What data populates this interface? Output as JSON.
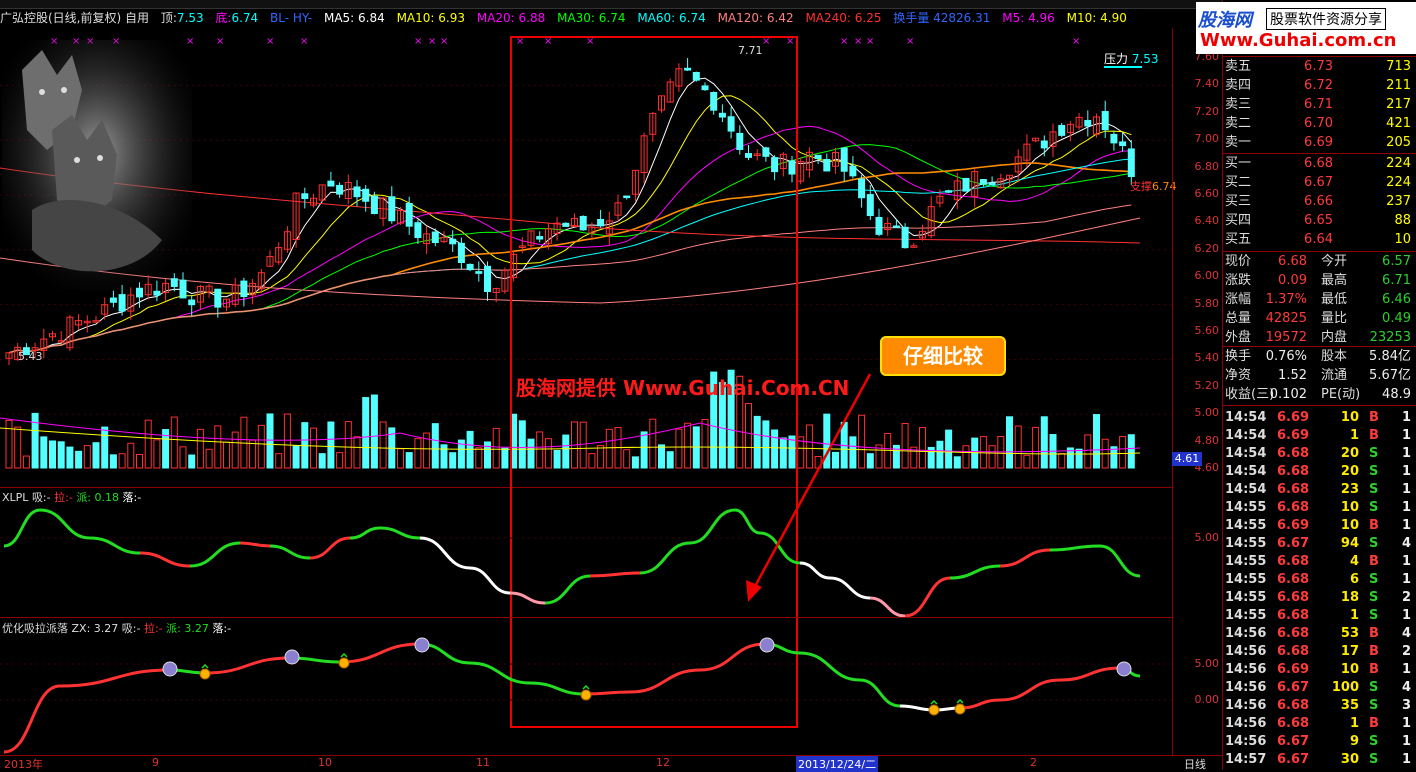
{
  "header": {
    "stock": "广弘控股(日线,前复权) 自用",
    "top_label": "顶:",
    "top_val": "7.53",
    "bottom_label": "底:",
    "bottom_val": "6.74",
    "extra": "BL- HY-",
    "ma5": "MA5: 6.84",
    "ma10": "MA10: 6.93",
    "ma20": "MA20: 6.88",
    "ma30": "MA30: 6.74",
    "ma60": "MA60: 6.74",
    "ma120": "MA120: 6.42",
    "ma240": "MA240: 6.25",
    "vol_label": "换手量 42826.31",
    "m5": "M5: 4.96",
    "m10": "M10: 4.90"
  },
  "chart_labels": {
    "pressure": "压力",
    "pressure_val": "7.53",
    "high_mark": "7.71",
    "low_mark": "5.43",
    "support": "支撑",
    "support_val": "6.74",
    "axis_current": "4.61"
  },
  "xlpl": {
    "title": "XLPL",
    "xi": "吸:-",
    "la": "拉:-",
    "pai": "派: 0.18",
    "luo": "落:-"
  },
  "zx": {
    "title": "优化吸拉派落",
    "zx": "ZX: 3.27",
    "xi": "吸:-",
    "la": "拉:-",
    "pai": "派: 3.27",
    "luo": "落:-"
  },
  "main_axis": [
    "7.60",
    "7.40",
    "7.20",
    "7.00",
    "6.80",
    "6.60",
    "6.40",
    "6.20",
    "6.00",
    "5.80",
    "5.60",
    "5.40",
    "5.20",
    "5.00",
    "4.80",
    "4.60"
  ],
  "xlpl_axis": [
    "5.00"
  ],
  "zx_axis": [
    "5.00",
    "0.00"
  ],
  "date_axis": {
    "y2013": "2013年",
    "m9": "9",
    "m10": "10",
    "m11": "11",
    "m12": "12",
    "cursor": "2013/12/24/二",
    "m2": "2",
    "period": "日线"
  },
  "callout": "仔细比较",
  "watermark": "股海网提供 Www.Guhai.Com.CN",
  "logo": {
    "top_left": "股海网",
    "top_right": "股票软件资源分享",
    "url": "Www.Guhai.com.cn"
  },
  "orderbook": {
    "asks": [
      {
        "label": "卖五",
        "price": "6.73",
        "vol": "713"
      },
      {
        "label": "卖四",
        "price": "6.72",
        "vol": "211"
      },
      {
        "label": "卖三",
        "price": "6.71",
        "vol": "217"
      },
      {
        "label": "卖二",
        "price": "6.70",
        "vol": "421"
      },
      {
        "label": "卖一",
        "price": "6.69",
        "vol": "205"
      }
    ],
    "bids": [
      {
        "label": "买一",
        "price": "6.68",
        "vol": "224"
      },
      {
        "label": "买二",
        "price": "6.67",
        "vol": "224"
      },
      {
        "label": "买三",
        "price": "6.66",
        "vol": "237"
      },
      {
        "label": "买四",
        "price": "6.65",
        "vol": "88"
      },
      {
        "label": "买五",
        "price": "6.64",
        "vol": "10"
      }
    ]
  },
  "quote": [
    {
      "l1": "现价",
      "v1": "6.68",
      "l2": "今开",
      "v2": "6.57"
    },
    {
      "l1": "涨跌",
      "v1": "0.09",
      "l2": "最高",
      "v2": "6.71"
    },
    {
      "l1": "涨幅",
      "v1": "1.37%",
      "l2": "最低",
      "v2": "6.46"
    },
    {
      "l1": "总量",
      "v1": "42825",
      "l2": "量比",
      "v2": "0.49"
    },
    {
      "l1": "外盘",
      "v1": "19572",
      "l2": "内盘",
      "v2": "23253"
    }
  ],
  "stats": [
    {
      "l1": "换手",
      "v1": "0.76%",
      "l2": "股本",
      "v2": "5.84亿"
    },
    {
      "l1": "净资",
      "v1": "1.52",
      "l2": "流通",
      "v2": "5.67亿"
    },
    {
      "l1": "收益(三)",
      "v1": "0.102",
      "l2": "PE(动)",
      "v2": "48.9"
    }
  ],
  "ticks": [
    {
      "t": "14:54",
      "p": "6.69",
      "v": "10",
      "s": "B",
      "n": "1"
    },
    {
      "t": "14:54",
      "p": "6.69",
      "v": "1",
      "s": "B",
      "n": "1"
    },
    {
      "t": "14:54",
      "p": "6.68",
      "v": "20",
      "s": "S",
      "n": "1"
    },
    {
      "t": "14:54",
      "p": "6.68",
      "v": "20",
      "s": "S",
      "n": "1"
    },
    {
      "t": "14:54",
      "p": "6.68",
      "v": "23",
      "s": "S",
      "n": "1"
    },
    {
      "t": "14:55",
      "p": "6.68",
      "v": "10",
      "s": "S",
      "n": "1"
    },
    {
      "t": "14:55",
      "p": "6.69",
      "v": "10",
      "s": "B",
      "n": "1"
    },
    {
      "t": "14:55",
      "p": "6.67",
      "v": "94",
      "s": "S",
      "n": "4"
    },
    {
      "t": "14:55",
      "p": "6.68",
      "v": "4",
      "s": "B",
      "n": "1"
    },
    {
      "t": "14:55",
      "p": "6.68",
      "v": "6",
      "s": "S",
      "n": "1"
    },
    {
      "t": "14:55",
      "p": "6.68",
      "v": "18",
      "s": "S",
      "n": "2"
    },
    {
      "t": "14:55",
      "p": "6.68",
      "v": "1",
      "s": "S",
      "n": "1"
    },
    {
      "t": "14:56",
      "p": "6.68",
      "v": "53",
      "s": "B",
      "n": "4"
    },
    {
      "t": "14:56",
      "p": "6.68",
      "v": "17",
      "s": "B",
      "n": "2"
    },
    {
      "t": "14:56",
      "p": "6.69",
      "v": "10",
      "s": "B",
      "n": "1"
    },
    {
      "t": "14:56",
      "p": "6.67",
      "v": "100",
      "s": "S",
      "n": "4"
    },
    {
      "t": "14:56",
      "p": "6.68",
      "v": "35",
      "s": "S",
      "n": "3"
    },
    {
      "t": "14:56",
      "p": "6.68",
      "v": "1",
      "s": "B",
      "n": "1"
    },
    {
      "t": "14:56",
      "p": "6.67",
      "v": "9",
      "s": "S",
      "n": "1"
    },
    {
      "t": "14:57",
      "p": "6.67",
      "v": "30",
      "s": "S",
      "n": "1"
    }
  ]
}
